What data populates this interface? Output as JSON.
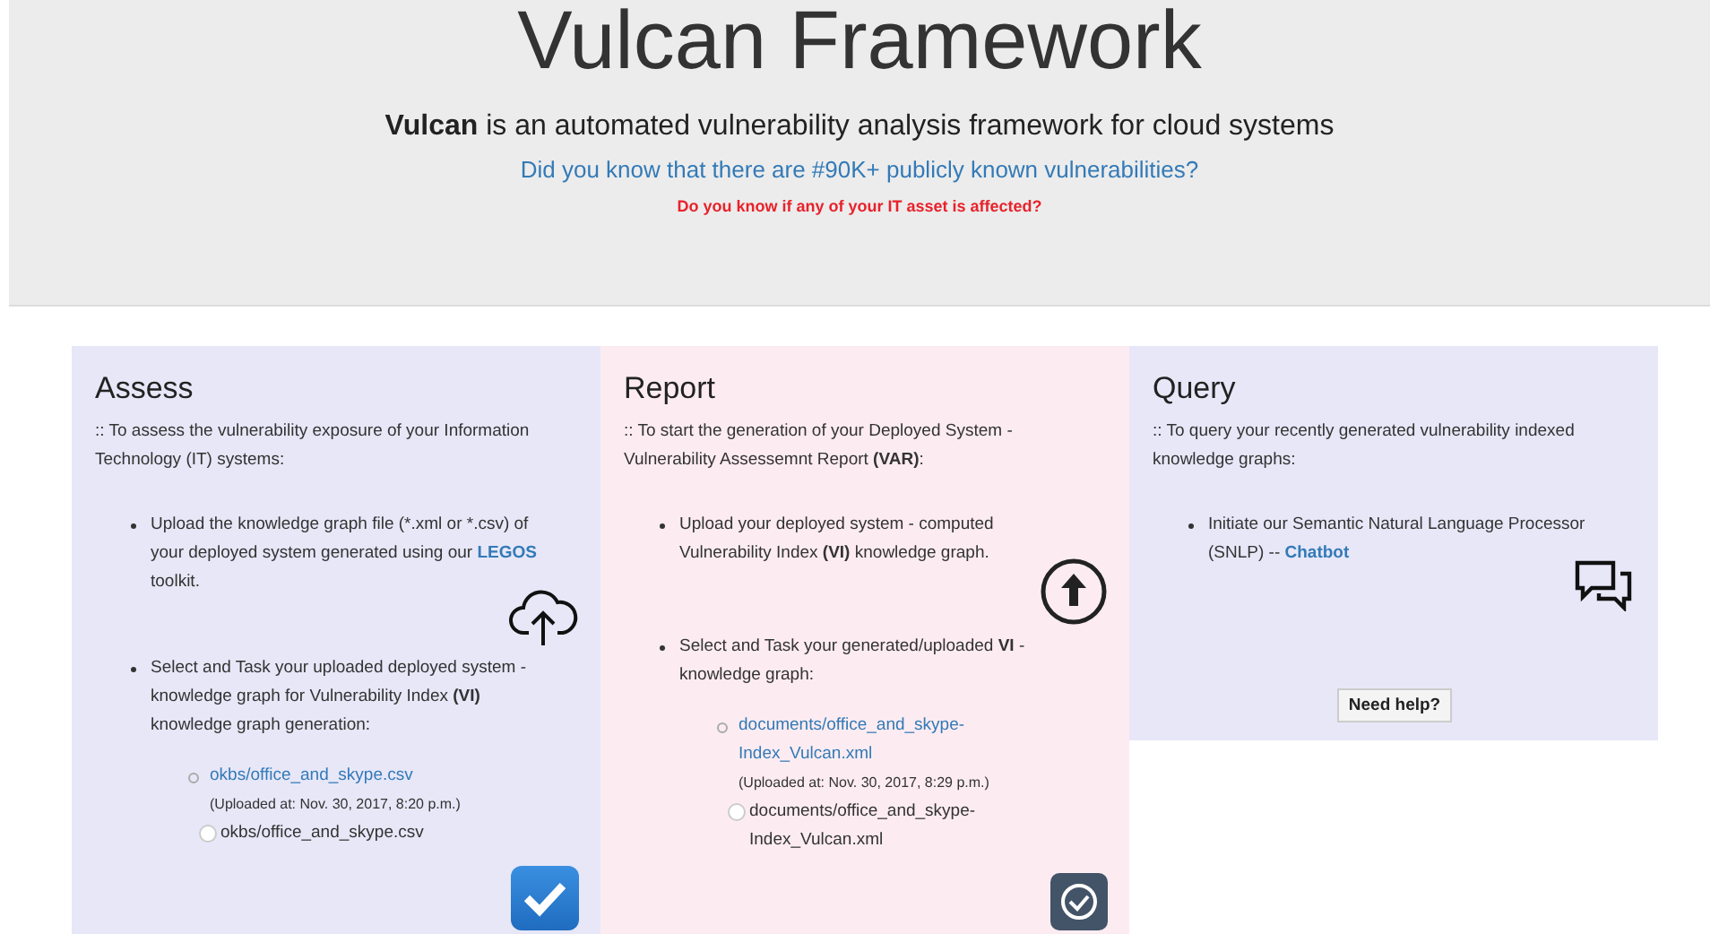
{
  "header": {
    "title": "Vulcan Framework",
    "tagline": "**Vulcan** is an automated vulnerability analysis framework for cloud systems",
    "question": "Did you know that there are #90K+ publicly known vulnerabilities?",
    "alert": "Do you know if any of your IT asset is affected?"
  },
  "panels": [
    {
      "title": "Assess",
      "intro": ":: To assess the vulnerability exposure of your Information Technology (IT) systems:",
      "bullets": [
        {
          "segments": [
            {
              "kind": "text",
              "text": "Upload the knowledge graph file (*.xml or *.csv) of your deployed system generated using our "
            },
            {
              "kind": "link",
              "text": "LEGOS"
            },
            {
              "kind": "text",
              "text": " toolkit."
            }
          ]
        },
        {
          "segments": [
            {
              "kind": "text",
              "text": "Select and Task your uploaded deployed system - knowledge graph for Vulnerability Index **(VI)** knowledge graph generation:"
            }
          ],
          "files": [
            {
              "link": "okbs/office_and_skype.csv",
              "note": "(Uploaded at: Nov. 30, 2017, 8:20 p.m.)",
              "radio": {
                "label": "okbs/office_and_skype.csv",
                "selected": false
              }
            }
          ]
        }
      ],
      "action": {
        "kind": "check-square"
      }
    },
    {
      "title": "Report",
      "intro": ":: To start the generation of your Deployed System - Vulnerability Assessemnt Report **(VAR)**:",
      "bullets": [
        {
          "segments": [
            {
              "kind": "text",
              "text": "Upload your deployed system - computed Vulnerability Index **(VI)** knowledge graph."
            }
          ]
        },
        {
          "segments": [
            {
              "kind": "text",
              "text": "Select and Task your generated/uploaded **VI** - knowledge graph:"
            }
          ],
          "files": [
            {
              "link": "documents/office_and_skype-Index_Vulcan.xml",
              "note": "(Uploaded at: Nov. 30, 2017, 8:29 p.m.)",
              "radio": {
                "label": "documents/office_and_skype-Index_Vulcan.xml",
                "selected": false
              }
            }
          ]
        }
      ],
      "action": {
        "kind": "check-circle"
      }
    },
    {
      "title": "Query",
      "intro": ":: To query your recently generated vulnerability indexed knowledge graphs:",
      "bullets": [
        {
          "segments": [
            {
              "kind": "text",
              "text": "Initiate our Semantic Natural Language Processor (SNLP) -- "
            },
            {
              "kind": "link",
              "text": "Chatbot"
            }
          ]
        }
      ],
      "action": {
        "kind": "text-button",
        "label": "Need help?"
      }
    }
  ]
}
